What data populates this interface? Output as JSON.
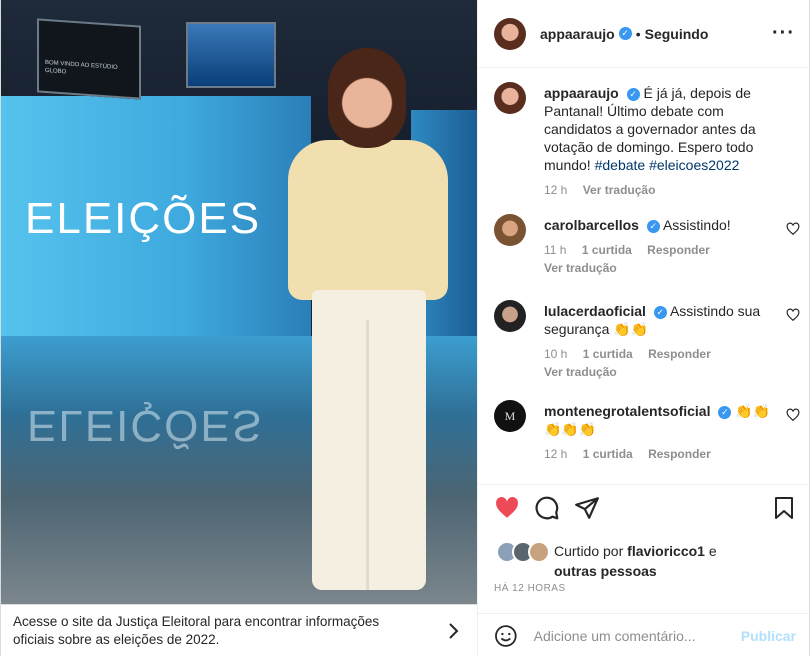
{
  "media": {
    "logo_text": "ELEIÇÕES",
    "screen_text": "BOM VINDO AO ESTÚDIO GLOBO"
  },
  "notice": {
    "text": "Acesse o site da Justiça Eleitoral para encontrar informações oficiais sobre as eleições de 2022."
  },
  "header": {
    "username": "appaaraujo",
    "dot": "•",
    "follow_label": "Seguindo",
    "more": "···"
  },
  "caption": {
    "username": "appaaraujo",
    "text": "É já já, depois de Pantanal! Último debate com candidatos a governador antes da votação de domingo. Espero todo mundo!",
    "hashtags": "#debate #eleicoes2022",
    "time": "12 h",
    "translate": "Ver tradução"
  },
  "comments": [
    {
      "username": "carolbarcellos",
      "text": "Assistindo!",
      "time": "11 h",
      "likes": "1 curtida",
      "reply": "Responder",
      "translate": "Ver tradução"
    },
    {
      "username": "lulacerdaoficial",
      "text": "Assistindo sua segurança 👏👏",
      "time": "10 h",
      "likes": "1 curtida",
      "reply": "Responder",
      "translate": "Ver tradução"
    },
    {
      "username": "montenegrotalentsoficial",
      "text": "👏👏 👏👏👏",
      "time": "12 h",
      "likes": "1 curtida",
      "reply": "Responder"
    }
  ],
  "likes": {
    "prefix": "Curtido por",
    "user": "flavioricco1",
    "suffix": "e",
    "others": "outras pessoas"
  },
  "post_time": "HÁ 12 HORAS",
  "add_comment": {
    "placeholder": "Adicione um comentário...",
    "publish": "Publicar"
  },
  "colors": {
    "like_red": "#ed4956",
    "verified_blue": "#3897f0",
    "link_blue": "#00376b",
    "publish_disabled": "#b2dffc"
  }
}
